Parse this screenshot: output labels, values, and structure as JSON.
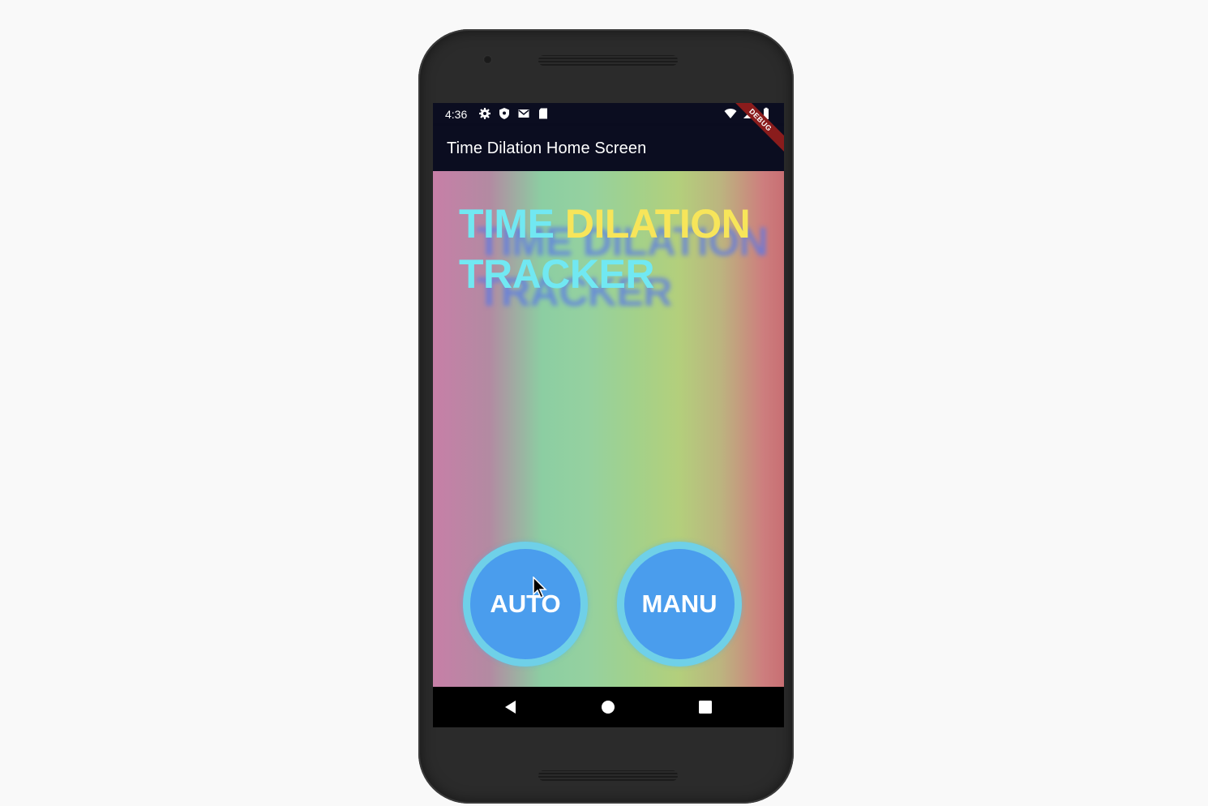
{
  "status_bar": {
    "time": "4:36",
    "left_icons": [
      "gear-icon",
      "shield-icon",
      "mail-icon",
      "sd-card-icon"
    ],
    "right_icons": [
      "wifi-icon",
      "signal-icon",
      "battery-icon"
    ]
  },
  "app_bar": {
    "title": "Time Dilation Home Screen",
    "debug_banner": "DEBUG"
  },
  "main": {
    "title_word_1": "TIME",
    "title_word_2": "DILATION",
    "title_word_3": "TRACKER",
    "auto_button_label": "AUTO",
    "manu_button_label": "MANU"
  },
  "nav_bar": {
    "items": [
      "back-icon",
      "home-icon",
      "recents-icon"
    ]
  },
  "colors": {
    "title_cyan": "#71e8f2",
    "title_yellow": "#f7e55a",
    "button_fill": "#4a9ded",
    "button_ring": "#6fd0e8",
    "app_bar_bg": "#0b0d20"
  }
}
